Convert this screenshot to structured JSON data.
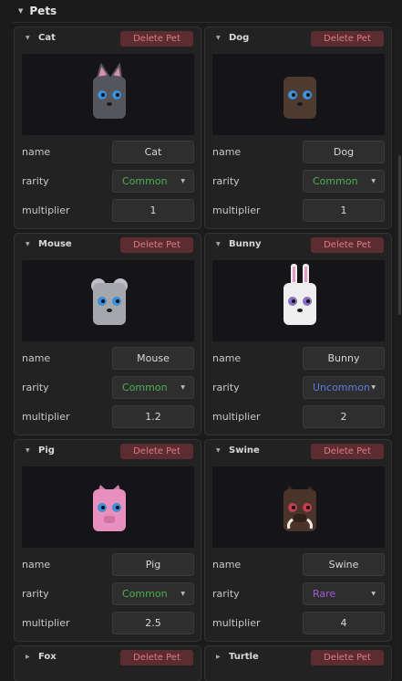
{
  "section": {
    "title": "Pets"
  },
  "delete_label": "Delete Pet",
  "fields": {
    "name": "name",
    "rarity": "rarity",
    "multiplier": "multiplier"
  },
  "rarity_colors": {
    "Common": "#4caf50",
    "Uncommon": "#5b7fe0",
    "Rare": "#a35ad6"
  },
  "pets": [
    {
      "title": "Cat",
      "name": "Cat",
      "rarity": "Common",
      "multiplier": "1",
      "body_color": "#55565c",
      "ear_color": "#d590b6"
    },
    {
      "title": "Dog",
      "name": "Dog",
      "rarity": "Common",
      "multiplier": "1",
      "body_color": "#4e3a2e",
      "ear_color": "#3b2b22"
    },
    {
      "title": "Mouse",
      "name": "Mouse",
      "rarity": "Common",
      "multiplier": "1.2",
      "body_color": "#a5a7ad",
      "ear_color": "#bfc0c5"
    },
    {
      "title": "Bunny",
      "name": "Bunny",
      "rarity": "Uncommon",
      "multiplier": "2",
      "body_color": "#eeeeee",
      "ear_color": "#e49ac4"
    },
    {
      "title": "Pig",
      "name": "Pig",
      "rarity": "Common",
      "multiplier": "2.5",
      "body_color": "#e88fbe",
      "ear_color": "#d07aaa"
    },
    {
      "title": "Swine",
      "name": "Swine",
      "rarity": "Rare",
      "multiplier": "4",
      "body_color": "#4a3328",
      "ear_color": "#3a271e"
    },
    {
      "title": "Fox"
    },
    {
      "title": "Turtle"
    }
  ]
}
